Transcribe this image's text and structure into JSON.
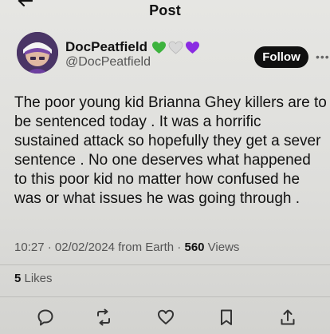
{
  "header": {
    "title": "Post"
  },
  "author": {
    "display_name": "DocPeatfield",
    "handle": "@DocPeatfield",
    "emoji_hearts": [
      "green-heart-icon",
      "white-heart-icon",
      "purple-heart-icon"
    ],
    "follow_label": "Follow"
  },
  "tweet": {
    "text": "The poor young kid Brianna Ghey killers are to be sentenced today . It was a horrific sustained attack so hopefully they get a sever sentence . No one deserves what happened to this poor kid no matter how confused he was or what issues he was going through ."
  },
  "meta": {
    "time_date": "10:27 · 02/02/2024",
    "source": " from Earth · ",
    "views_count": "560",
    "views_label": " Views"
  },
  "engagement": {
    "likes_count": "5",
    "likes_label": " Likes"
  },
  "actions": [
    "reply-icon",
    "repost-icon",
    "like-icon",
    "bookmark-icon",
    "share-icon"
  ],
  "colors": {
    "background": "#e2e2df",
    "text": "#111111",
    "follow_button": "#101010",
    "green_heart": "#3db33d",
    "white_heart": "#d8d8d8",
    "purple_heart": "#8a2be2"
  }
}
